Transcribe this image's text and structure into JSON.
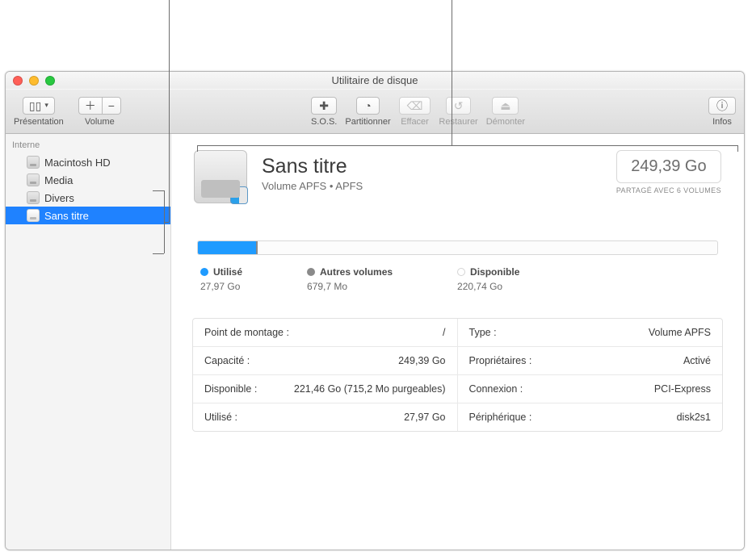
{
  "window_title": "Utilitaire de disque",
  "toolbar": {
    "presentation_label": "Présentation",
    "volume_label": "Volume",
    "sos_label": "S.O.S.",
    "partition_label": "Partitionner",
    "erase_label": "Effacer",
    "restore_label": "Restaurer",
    "unmount_label": "Démonter",
    "info_label": "Infos"
  },
  "sidebar": {
    "section_internal": "Interne",
    "items": [
      {
        "label": "Macintosh HD"
      },
      {
        "label": "Media"
      },
      {
        "label": "Divers"
      },
      {
        "label": "Sans titre"
      }
    ]
  },
  "volume": {
    "title": "Sans titre",
    "subtitle": "Volume APFS • APFS",
    "size": "249,39 Go",
    "shared_caption": "PARTAGÉ AVEC 6 VOLUMES"
  },
  "usage": {
    "used_label": "Utilisé",
    "used_value": "27,97 Go",
    "used_pct": 11.2,
    "other_label": "Autres volumes",
    "other_value": "679,7 Mo",
    "other_pct": 0.3,
    "avail_label": "Disponible",
    "avail_value": "220,74 Go"
  },
  "details": {
    "rows": [
      {
        "label": "Point de montage :",
        "value": "/"
      },
      {
        "label": "Type :",
        "value": "Volume APFS"
      },
      {
        "label": "Capacité :",
        "value": "249,39 Go"
      },
      {
        "label": "Propriétaires :",
        "value": "Activé"
      },
      {
        "label": "Disponible :",
        "value": "221,46 Go (715,2 Mo purgeables)"
      },
      {
        "label": "Connexion :",
        "value": "PCI-Express"
      },
      {
        "label": "Utilisé :",
        "value": "27,97 Go"
      },
      {
        "label": "Périphérique :",
        "value": "disk2s1"
      }
    ]
  }
}
